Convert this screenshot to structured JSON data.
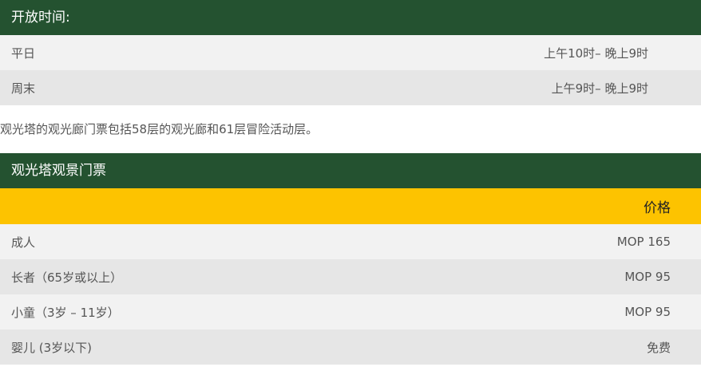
{
  "hours": {
    "title": "开放时间:",
    "rows": [
      {
        "day": "平日",
        "time": "上午10时– 晚上9时"
      },
      {
        "day": "周末",
        "time": "上午9时– 晚上9时"
      }
    ]
  },
  "note": "观光塔的观光廊门票包括58层的观光廊和61层冒险活动层。",
  "tickets": {
    "title": "观光塔观景门票",
    "price_header": "价格",
    "rows": [
      {
        "type": "成人",
        "price": "MOP 165"
      },
      {
        "type": "长者（65岁或以上）",
        "price": "MOP 95"
      },
      {
        "type": "小童（3岁 – 11岁）",
        "price": "MOP 95"
      },
      {
        "type": "婴儿 (3岁以下)",
        "price": "免费"
      }
    ]
  },
  "colors": {
    "header_green": "#245230",
    "price_yellow": "#fdc300",
    "row_light": "#f2f2f2",
    "row_dark": "#e6e6e6"
  }
}
